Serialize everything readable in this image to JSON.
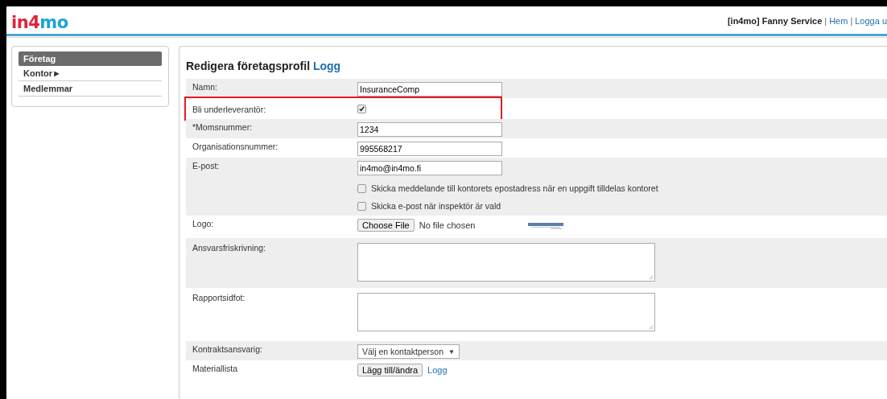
{
  "header": {
    "logo": [
      {
        "text": "in4",
        "color": "#e0243a"
      },
      {
        "text": "mo",
        "color": "#1ba4da"
      }
    ],
    "user": "[in4mo] Fanny Service",
    "separator": "|",
    "links": [
      "Hem",
      "Logga u"
    ]
  },
  "sidebar": {
    "items": [
      {
        "label": "Företag",
        "selected": true
      },
      {
        "label": "Kontor",
        "selected": false,
        "arrow": "►"
      },
      {
        "label": "Medlemmar",
        "selected": false
      }
    ]
  },
  "form": {
    "title": "Redigera företagsprofil",
    "title_link": "Logg",
    "rows": [
      {
        "label": "Namn:",
        "kind": "text",
        "value": "InsuranceComp",
        "highlighted": false
      },
      {
        "label": "Bli underleverantör:",
        "kind": "checkbox",
        "checked": true,
        "highlighted": true
      },
      {
        "label": "*Momsnummer:",
        "kind": "text",
        "value": "1234",
        "highlighted": false
      },
      {
        "label": "Organisationsnummer:",
        "kind": "text",
        "value": "995568217",
        "highlighted": false
      },
      {
        "label": "E-post:",
        "kind": "email",
        "value": "in4mo@in4mo.fi",
        "highlighted": false,
        "options": [
          {
            "label": "Skicka meddelande till kontorets epostadress när en uppgift tilldelas kontoret",
            "checked": false
          },
          {
            "label": "Skicka e-post när inspektör är vald",
            "checked": false
          }
        ]
      },
      {
        "label": "Logo:",
        "kind": "file",
        "button": "Choose File",
        "status": "No file chosen",
        "highlighted": false
      },
      {
        "label": "Ansvarsfriskrivning:",
        "kind": "textarea",
        "highlighted": false
      },
      {
        "label": "Rapportsidfot:",
        "kind": "textarea",
        "highlighted": false
      },
      {
        "label": "Kontraktsansvarig:",
        "kind": "select",
        "value": "Välj en kontaktperson",
        "caret": "▼",
        "highlighted": false
      },
      {
        "label": "Materiallista",
        "kind": "button",
        "button": "Lägg till/ändra",
        "link": "Logg",
        "highlighted": false
      }
    ]
  }
}
